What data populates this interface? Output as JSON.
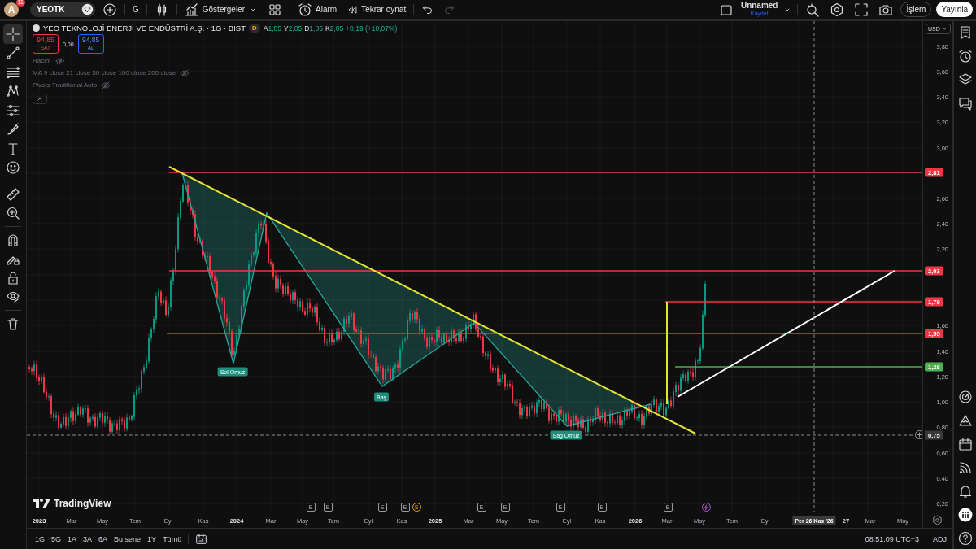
{
  "top_bar": {
    "avatar": "A",
    "notification_count": "11",
    "symbol": "YEOTK",
    "interval": "G",
    "indicators_label": "Göstergeler",
    "alarm_label": "Alarm",
    "replay_label": "Tekrar oynat",
    "layout_name": "Unnamed",
    "save_label": "Kaydet",
    "trade_label": "İşlem",
    "publish_label": "Yayınla"
  },
  "left_tools": [
    {
      "kind": "crosshair",
      "selected": true
    },
    {
      "kind": "trend-line",
      "selected": false
    },
    {
      "kind": "fib-lines",
      "selected": false
    },
    {
      "kind": "zigzag-pattern",
      "selected": false
    },
    {
      "kind": "forecast-lines",
      "selected": false
    },
    {
      "kind": "brush",
      "selected": false
    },
    {
      "kind": "text",
      "selected": false
    },
    {
      "kind": "smiley",
      "selected": false
    },
    {
      "kind": "ruler",
      "selected": false
    },
    {
      "kind": "zoom-in",
      "selected": false
    },
    {
      "kind": "magnet",
      "selected": false
    },
    {
      "kind": "pencil-lock",
      "selected": false
    },
    {
      "kind": "lock",
      "selected": false
    },
    {
      "kind": "eye",
      "selected": false
    },
    {
      "kind": "trash",
      "selected": false
    }
  ],
  "legend": {
    "title": "YEO TEKNOLOJİ ENERJİ VE ENDÜSTRİ A.Ş. · 1G · BIST",
    "market_badge": "D",
    "ohlc": [
      {
        "key": "A",
        "value": "1,85"
      },
      {
        "key": "Y",
        "value": "2,05"
      },
      {
        "key": "D",
        "value": "1,85"
      },
      {
        "key": "K",
        "value": "2,05"
      }
    ],
    "change": "+0,19 (+10,07%)",
    "sell": {
      "price": "94,85",
      "label": "SAT"
    },
    "spread": "0,00",
    "buy": {
      "price": "94,85",
      "label": "AL"
    },
    "indicators": [
      {
        "name": "Hacim",
        "hidden": true
      },
      {
        "name": "MA 9 close 21 close 50 close 100 close 200 close",
        "hidden": true
      },
      {
        "name": "Pivots Traditional Auto",
        "hidden": true
      }
    ]
  },
  "chart": {
    "logo": "TradingView",
    "pattern_labels": [
      "Sol Omuz",
      "Baş",
      "Sağ Omuz"
    ],
    "levels": [
      {
        "price": "2,81",
        "color": "#f23645"
      },
      {
        "price": "2,03",
        "color": "#f23645"
      },
      {
        "price": "1,79",
        "color": "#f23645"
      },
      {
        "price": "1,55",
        "color": "#f23645"
      },
      {
        "price": "1,28",
        "color": "#4caf50"
      }
    ],
    "crosshair": {
      "price": "0,75",
      "date": "Per 26 Kas '26"
    },
    "events": [
      {
        "kind": "earnings",
        "label": "E"
      },
      {
        "kind": "earnings",
        "label": "E"
      },
      {
        "kind": "earnings",
        "label": "E"
      },
      {
        "kind": "earnings",
        "label": "E"
      },
      {
        "kind": "dividend",
        "label": "S"
      },
      {
        "kind": "earnings",
        "label": "E"
      },
      {
        "kind": "earnings",
        "label": "E"
      },
      {
        "kind": "earnings",
        "label": "E"
      },
      {
        "kind": "earnings",
        "label": "E"
      },
      {
        "kind": "earnings",
        "label": "E"
      },
      {
        "kind": "split"
      }
    ]
  },
  "price_axis": {
    "currency": "USD",
    "ticks": [
      "3,80",
      "3,60",
      "3,40",
      "3,20",
      "3,00",
      "2,60",
      "2,40",
      "2,20",
      "1,60",
      "1,40",
      "1,20",
      "1,00",
      "0,80",
      "0,60",
      "0,40",
      "0,20"
    ]
  },
  "time_axis": {
    "labels": [
      {
        "text": "2023",
        "kind": "year"
      },
      {
        "text": "Mar",
        "kind": "month"
      },
      {
        "text": "May",
        "kind": "month"
      },
      {
        "text": "Tem",
        "kind": "month"
      },
      {
        "text": "Eyl",
        "kind": "month"
      },
      {
        "text": "Kas",
        "kind": "month"
      },
      {
        "text": "2024",
        "kind": "year"
      },
      {
        "text": "Mar",
        "kind": "month"
      },
      {
        "text": "May",
        "kind": "month"
      },
      {
        "text": "Tem",
        "kind": "month"
      },
      {
        "text": "Eyl",
        "kind": "month"
      },
      {
        "text": "Kas",
        "kind": "month"
      },
      {
        "text": "2025",
        "kind": "year"
      },
      {
        "text": "Mar",
        "kind": "month"
      },
      {
        "text": "May",
        "kind": "month"
      },
      {
        "text": "Tem",
        "kind": "month"
      },
      {
        "text": "Eyl",
        "kind": "month"
      },
      {
        "text": "Kas",
        "kind": "month"
      },
      {
        "text": "2026",
        "kind": "year"
      },
      {
        "text": "Mar",
        "kind": "month"
      },
      {
        "text": "May",
        "kind": "month"
      },
      {
        "text": "Tem",
        "kind": "month"
      },
      {
        "text": "Eyl",
        "kind": "month"
      },
      {
        "text": "27",
        "kind": "year"
      },
      {
        "text": "Mar",
        "kind": "month"
      },
      {
        "text": "May",
        "kind": "month"
      }
    ]
  },
  "right_sidebar": {
    "top": [
      {
        "kind": "watchlist"
      },
      {
        "kind": "alarm-clock"
      },
      {
        "kind": "layers"
      },
      {
        "kind": "chat"
      }
    ],
    "bottom": [
      {
        "kind": "target"
      },
      {
        "kind": "mountains"
      },
      {
        "kind": "calendar"
      },
      {
        "kind": "broadcast"
      },
      {
        "kind": "bell"
      },
      {
        "kind": "apps"
      },
      {
        "kind": "help"
      }
    ]
  },
  "range_bar": {
    "ranges": [
      "1G",
      "5G",
      "1A",
      "3A",
      "6A",
      "Bu sene",
      "1Y",
      "Tümü"
    ],
    "time": "08:51:09 UTC+3",
    "adjustment": "ADJ"
  }
}
